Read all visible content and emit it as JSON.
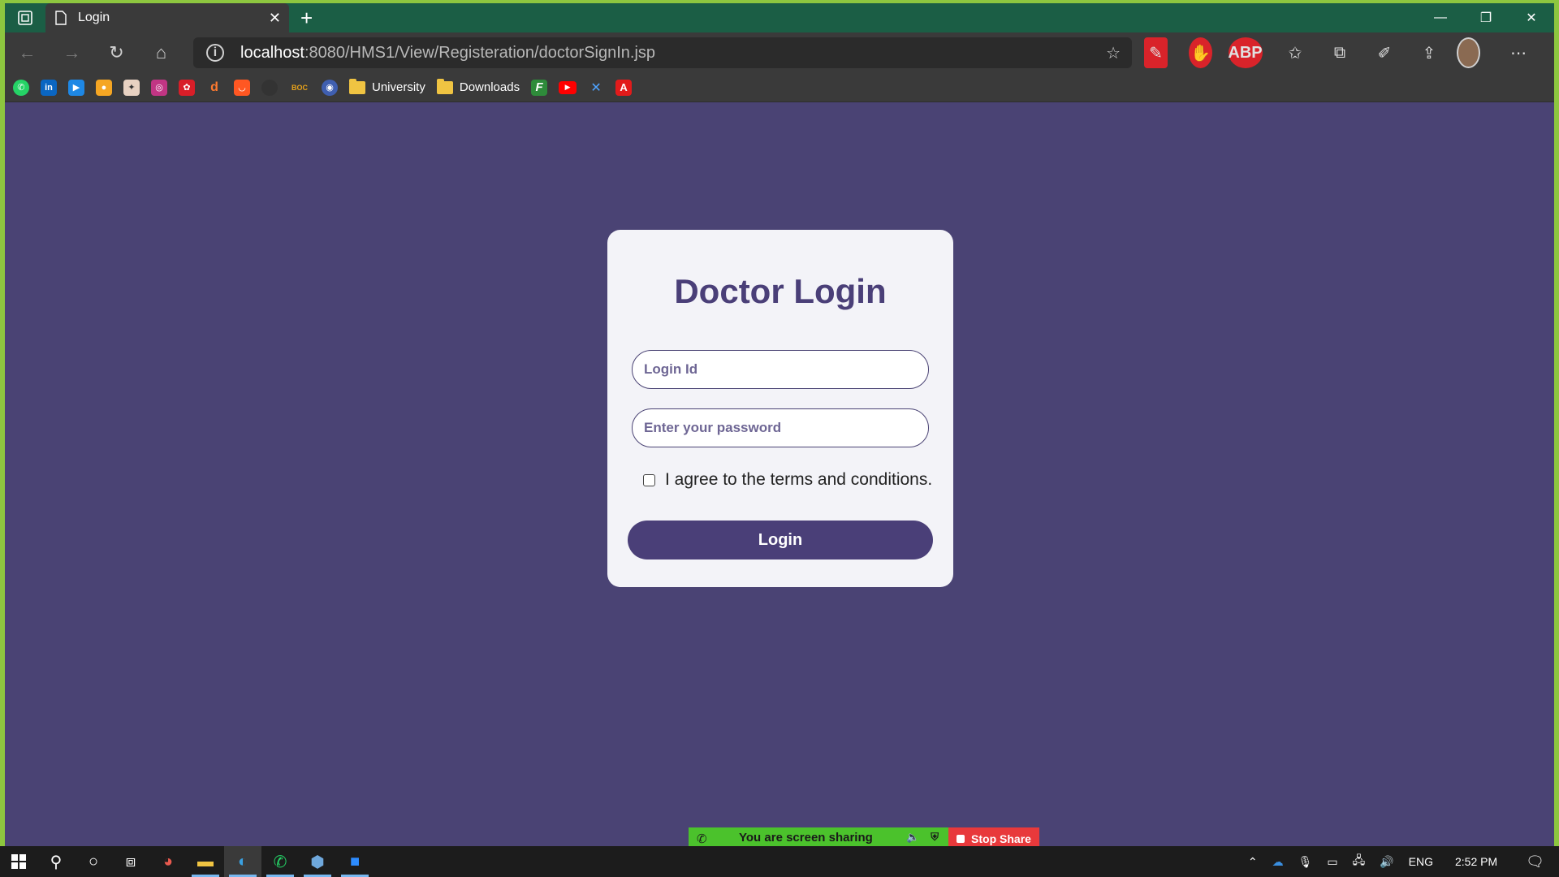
{
  "browser": {
    "tab_title": "Login",
    "new_tab_symbol": "+",
    "url_host": "localhost",
    "url_path": ":8080/HMS1/View/Registeration/doctorSignIn.jsp",
    "ext_abp": "ABP"
  },
  "bookmarks": {
    "university": "University",
    "downloads": "Downloads",
    "boc": "BOC"
  },
  "login": {
    "title": "Doctor Login",
    "login_id_placeholder": "Login Id",
    "password_placeholder": "Enter your password",
    "terms_label": "I agree to the terms and conditions.",
    "login_button": "Login"
  },
  "sharebar": {
    "status": "You are screen sharing",
    "stop_label": "Stop Share"
  },
  "taskbar": {
    "language": "ENG",
    "time": "2:52 PM"
  },
  "colors": {
    "page_background": "#4a4374",
    "card_background": "#f3f3f8",
    "accent": "#4a3f78",
    "title_bar": "#1b5e45",
    "share_green": "#4bc22c",
    "stop_red": "#e8393b"
  },
  "icons": [
    "workspaces-icon",
    "doc-icon",
    "close-icon",
    "minimize-icon",
    "restore-icon",
    "back-icon",
    "forward-icon",
    "refresh-icon",
    "home-icon",
    "info-icon",
    "add-favorite-icon",
    "favorites-icon",
    "collections-icon",
    "share-icon",
    "more-icon",
    "windows-start-icon",
    "search-icon",
    "cortana-icon",
    "task-view-icon"
  ]
}
